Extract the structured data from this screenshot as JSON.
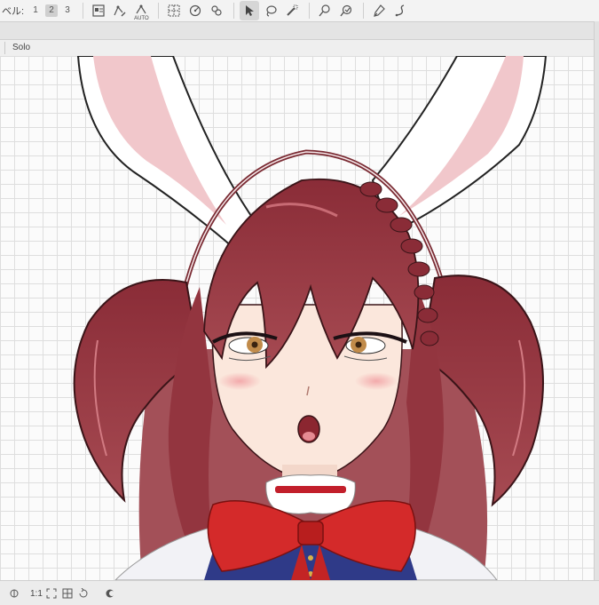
{
  "toolbar": {
    "level_label": "ベル:",
    "levels": [
      "1",
      "2",
      "3"
    ],
    "active_level": "2",
    "auto_tag": "AUTO"
  },
  "panel": {
    "solo_label": "Solo"
  },
  "status": {
    "zoom_text": "1:1"
  },
  "colors": {
    "toolbar_bg": "#f3f3f3",
    "canvas_bg": "#fbfbfb",
    "grid": "#dedede",
    "hair": "#7a2b33",
    "ribbon": "#d42a2a"
  }
}
